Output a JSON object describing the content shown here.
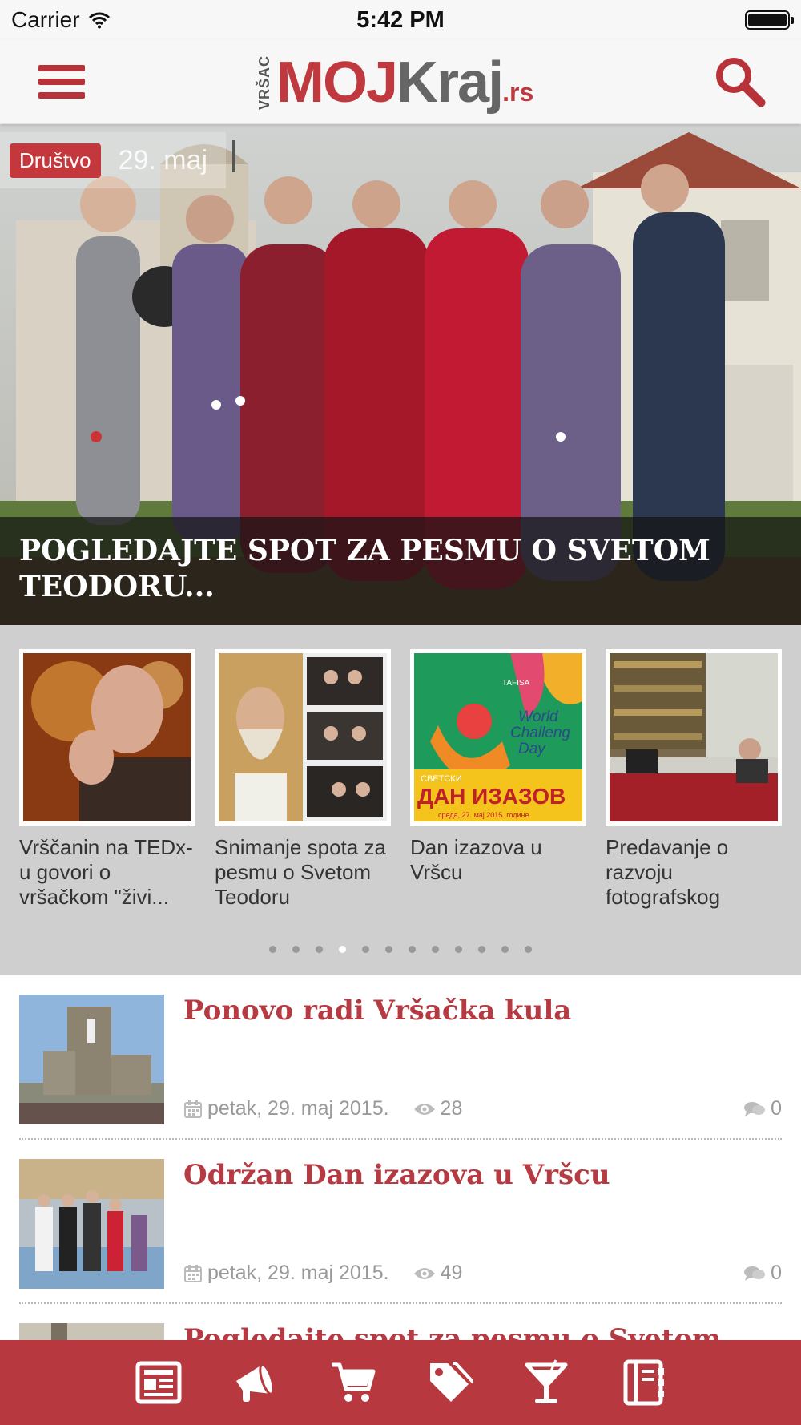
{
  "status_bar": {
    "carrier": "Carrier",
    "time": "5:42 PM",
    "battery_level": 1.0
  },
  "header": {
    "logo": {
      "city": "VRŠAC",
      "brand_main": "MOJ",
      "brand_second": "Kraj",
      "tld": ".rs"
    },
    "icons": [
      "menu-icon",
      "search-icon"
    ]
  },
  "hero": {
    "category": "Društvo",
    "date": "29. maj",
    "title": "POGLEDAJTE SPOT ZA PESMU O SVETOM TEODORU..."
  },
  "carousel": {
    "items": [
      {
        "title": "Vrščanin na TEDx-u govori o vršačkom \"živi..."
      },
      {
        "title": "Snimanje spota za pesmu o Svetom Teodoru"
      },
      {
        "title": "Dan izazova u Vršcu",
        "image_text": {
          "org": "TAFISA",
          "line1": "World",
          "line2": "Challeng",
          "line3": "Day",
          "banner": "СВЕТСКИ",
          "banner_big": "ДАН ИЗАЗОВ",
          "sub": "среда, 27. мај 2015. године"
        }
      },
      {
        "title": "Predavanje o razvoju fotografskog"
      }
    ],
    "page_count": 12,
    "active_index": 3
  },
  "news": [
    {
      "title": "Ponovo radi Vršačka kula",
      "date": "petak, 29. maj 2015.",
      "views": "28",
      "comments": "0"
    },
    {
      "title": "Održan Dan izazova u Vršcu",
      "date": "petak, 29. maj 2015.",
      "views": "49",
      "comments": "0"
    },
    {
      "title": "Pogledajte spot za pesmu o Svetom"
    }
  ],
  "tab_bar": [
    "news-icon",
    "megaphone-icon",
    "cart-icon",
    "tags-icon",
    "cocktail-icon",
    "directory-icon"
  ],
  "colors": {
    "brand_red": "#b8323a",
    "tab_bar": "#b7393f",
    "title_red": "#b53a41",
    "carousel_bg": "#cfcfcf"
  }
}
